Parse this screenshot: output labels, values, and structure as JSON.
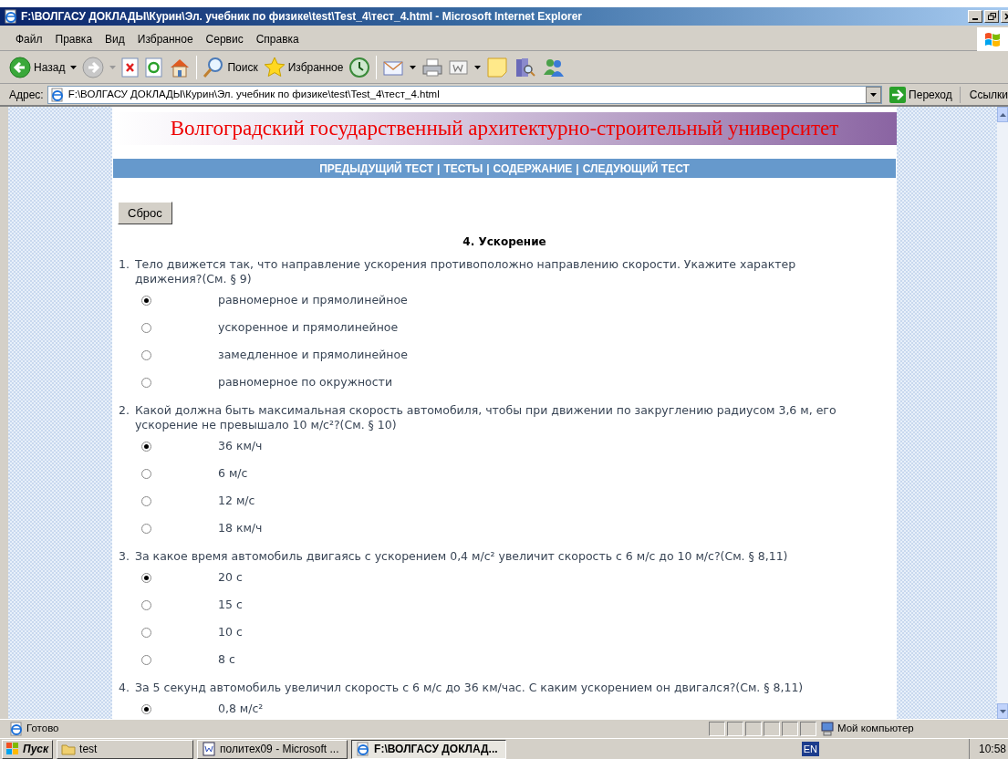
{
  "window": {
    "title": "F:\\ВОЛГАСУ ДОКЛАДЫ\\Курин\\Эл. учебник по физике\\test\\Test_4\\тест_4.html - Microsoft Internet Explorer"
  },
  "menu": [
    "Файл",
    "Правка",
    "Вид",
    "Избранное",
    "Сервис",
    "Справка"
  ],
  "toolbar": {
    "back": "Назад",
    "search": "Поиск",
    "favorites": "Избранное"
  },
  "address": {
    "label": "Адрес:",
    "value": "F:\\ВОЛГАСУ ДОКЛАДЫ\\Курин\\Эл. учебник по физике\\test\\Test_4\\тест_4.html",
    "go": "Переход",
    "links": "Ссылки"
  },
  "page": {
    "banner": "Волгоградский государственный архитектурно-строительный университет",
    "nav": [
      "ПРЕДЫДУЩИЙ ТЕСТ",
      "ТЕСТЫ",
      "СОДЕРЖАНИЕ",
      "СЛЕДУЮЩИЙ ТЕСТ"
    ],
    "nav_separator": "|",
    "reset": "Сброс",
    "heading": "4. Ускорение",
    "questions": [
      {
        "number": "1.",
        "text": "Тело движется так, что направление ускорения противоположно направлению скорости. Укажите характер движения?(См. § 9)",
        "options": [
          {
            "label": "равномерное и прямолинейное",
            "selected": true
          },
          {
            "label": "ускоренное и прямолинейное",
            "selected": false
          },
          {
            "label": "замедленное и прямолинейное",
            "selected": false
          },
          {
            "label": "равномерное по окружности",
            "selected": false
          }
        ]
      },
      {
        "number": "2.",
        "text": "Какой должна быть максимальная скорость автомобиля, чтобы при движении по закруглению радиусом 3,6 м, его ускорение не превышало 10 м/с²?(См. § 10)",
        "options": [
          {
            "label": "36 км/ч",
            "selected": true
          },
          {
            "label": "6 м/с",
            "selected": false
          },
          {
            "label": "12 м/с",
            "selected": false
          },
          {
            "label": "18 км/ч",
            "selected": false
          }
        ]
      },
      {
        "number": "3.",
        "text": "За какое время автомобиль двигаясь с ускорением 0,4 м/с² увеличит скорость с 6 м/с до 10 м/с?(См. § 8,11)",
        "options": [
          {
            "label": "20 с",
            "selected": true
          },
          {
            "label": "15 с",
            "selected": false
          },
          {
            "label": "10 с",
            "selected": false
          },
          {
            "label": "8 с",
            "selected": false
          }
        ]
      },
      {
        "number": "4.",
        "text": "За 5 секунд автомобиль увеличил скорость с 6 м/с до 36 км/час. С каким ускорением он двигался?(См. § 8,11)",
        "options": [
          {
            "label": "0,8 м/с²",
            "selected": true
          }
        ]
      }
    ]
  },
  "status_bar": {
    "text": "Готово",
    "zone": "Мой компьютер"
  },
  "taskbar": {
    "start": "Пуск",
    "tasks": [
      {
        "kind": "folder",
        "label": "test",
        "selected": false
      },
      {
        "kind": "word",
        "label": "политех09 - Microsoft ...",
        "selected": false
      },
      {
        "kind": "ie",
        "label": "F:\\ВОЛГАСУ ДОКЛАД...",
        "selected": true
      }
    ],
    "language": "EN",
    "clock": "10:58"
  }
}
